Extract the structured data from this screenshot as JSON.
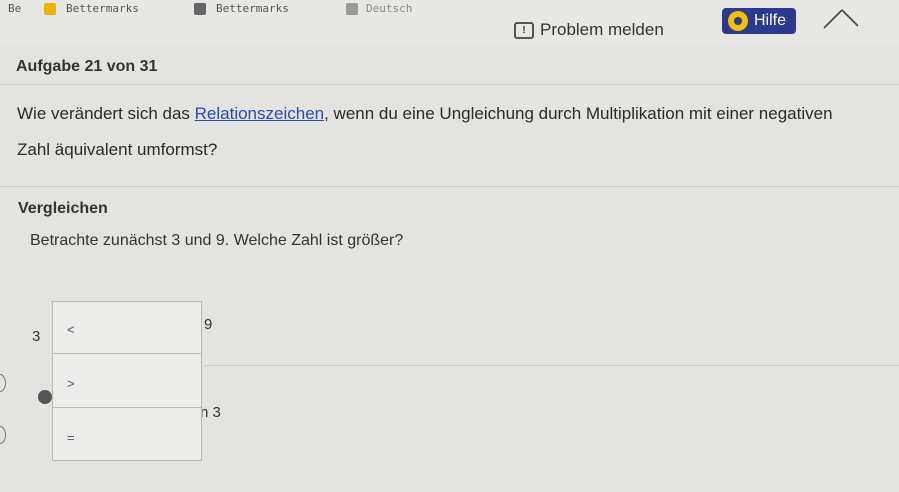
{
  "bookmarks": {
    "item0": "Be",
    "item1": "Bettermarks",
    "item2": "Bettermarks",
    "item3": "Deutsch"
  },
  "header": {
    "task_label": "Aufgabe 21 von 31",
    "report_label": "Problem melden",
    "help_label": "Hilfe"
  },
  "question": {
    "before": "Wie verändert sich das ",
    "link": "Relationszeichen",
    "after": ", wenn du eine Ungleichung durch Multiplikation mit einer negativen Zahl äquivalent umformst?"
  },
  "section": {
    "title": "Vergleichen",
    "prompt": "Betrachte zunächst 3 und 9. Welche Zahl ist größer?"
  },
  "comparison": {
    "left": "3",
    "right": "9",
    "suffix": "n 3",
    "options": [
      "<",
      ">",
      "="
    ]
  },
  "colors": {
    "accent": "#2b3a8f",
    "help_icon": "#f2c200",
    "link": "#2b48b8"
  }
}
